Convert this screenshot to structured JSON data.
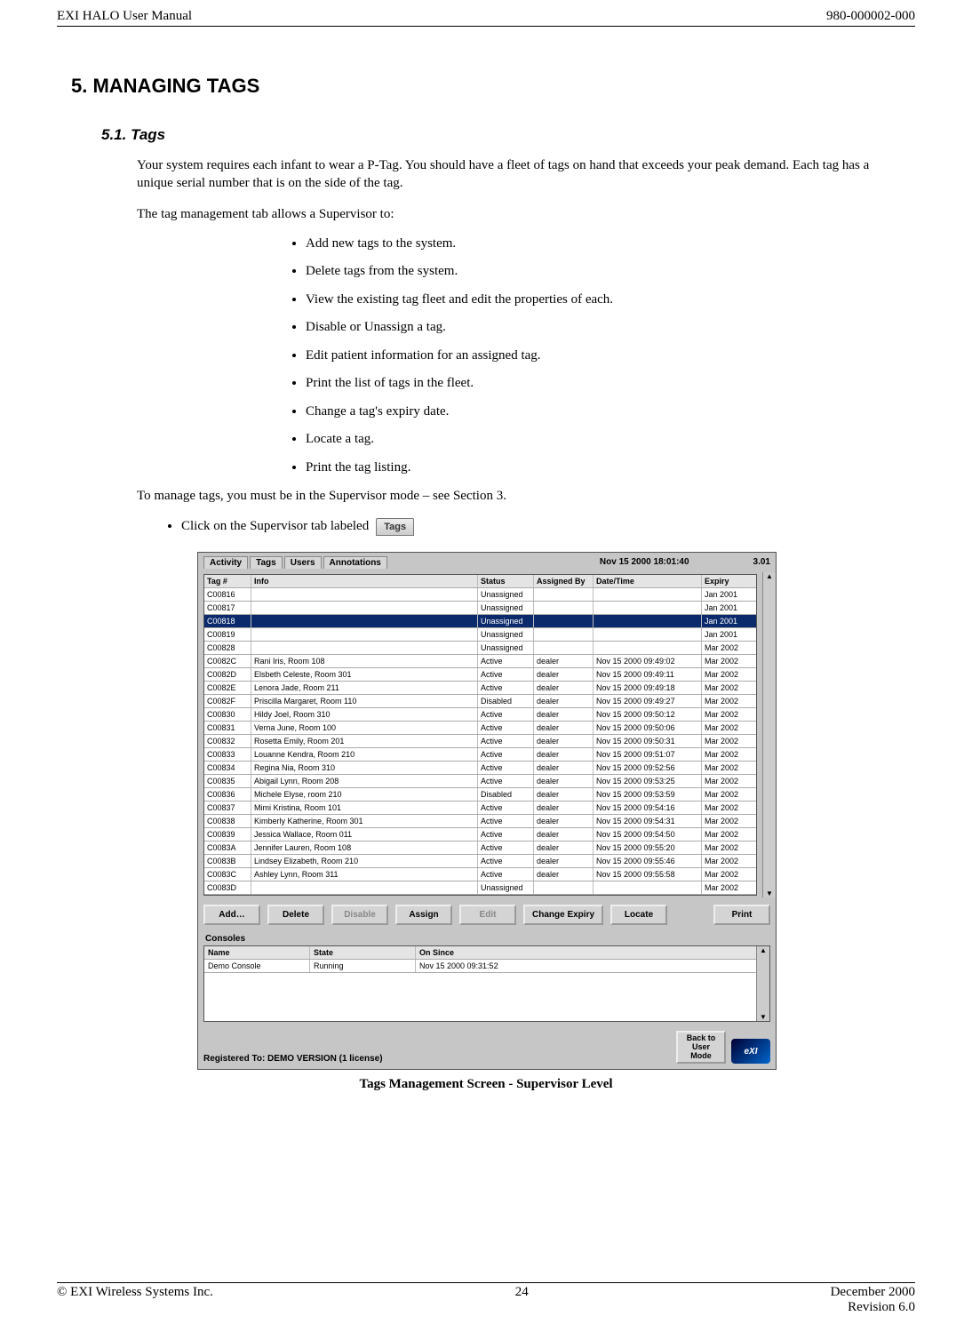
{
  "header": {
    "left": "EXI HALO User Manual",
    "right": "980-000002-000"
  },
  "section": {
    "h1": "5.  MANAGING TAGS",
    "h2": "5.1.  Tags"
  },
  "para1": "Your system requires each infant to wear a P-Tag.  You should have a fleet of tags on hand that exceeds your peak demand.  Each tag has a unique serial number that is on the side of the tag.",
  "para2": "The tag management tab allows a Supervisor to:",
  "bullets": [
    "Add new tags to the system.",
    "Delete tags from the system.",
    "View the existing tag fleet and edit the properties of each.",
    "Disable or Unassign a tag.",
    "Edit patient information for an assigned tag.",
    "Print the list of tags in the fleet.",
    "Change a tag's expiry date.",
    "Locate a tag.",
    "Print the tag listing."
  ],
  "para3": "To manage tags, you must be in the Supervisor mode – see Section 3.",
  "click_line_prefix": "Click on the Supervisor tab labeled",
  "tab_icon_label": "Tags",
  "screenshot": {
    "tabs": [
      "Activity",
      "Tags",
      "Users",
      "Annotations"
    ],
    "clock": "Nov 15 2000  18:01:40",
    "volume": "3.01",
    "columns": {
      "tag": "Tag #",
      "info": "Info",
      "status": "Status",
      "assigned": "Assigned By",
      "date": "Date/Time",
      "expiry": "Expiry"
    },
    "rows": [
      {
        "tag": "C00816",
        "info": "",
        "status": "Unassigned",
        "assigned": "",
        "date": "",
        "expiry": "Jan 2001"
      },
      {
        "tag": "C00817",
        "info": "",
        "status": "Unassigned",
        "assigned": "",
        "date": "",
        "expiry": "Jan 2001"
      },
      {
        "tag": "C00818",
        "info": "",
        "status": "Unassigned",
        "assigned": "",
        "date": "",
        "expiry": "Jan 2001",
        "selected": true
      },
      {
        "tag": "C00819",
        "info": "",
        "status": "Unassigned",
        "assigned": "",
        "date": "",
        "expiry": "Jan 2001"
      },
      {
        "tag": "C00828",
        "info": "",
        "status": "Unassigned",
        "assigned": "",
        "date": "",
        "expiry": "Mar 2002"
      },
      {
        "tag": "C0082C",
        "info": "Rani Iris, Room 108",
        "status": "Active",
        "assigned": "dealer",
        "date": "Nov 15 2000  09:49:02",
        "expiry": "Mar 2002"
      },
      {
        "tag": "C0082D",
        "info": "Elsbeth Celeste, Room 301",
        "status": "Active",
        "assigned": "dealer",
        "date": "Nov 15 2000  09:49:11",
        "expiry": "Mar 2002"
      },
      {
        "tag": "C0082E",
        "info": "Lenora Jade, Room 211",
        "status": "Active",
        "assigned": "dealer",
        "date": "Nov 15 2000  09:49:18",
        "expiry": "Mar 2002"
      },
      {
        "tag": "C0082F",
        "info": "Priscilla Margaret, Room 110",
        "status": "Disabled",
        "assigned": "dealer",
        "date": "Nov 15 2000  09:49:27",
        "expiry": "Mar 2002"
      },
      {
        "tag": "C00830",
        "info": "Hildy Joel, Room 310",
        "status": "Active",
        "assigned": "dealer",
        "date": "Nov 15 2000  09:50:12",
        "expiry": "Mar 2002"
      },
      {
        "tag": "C00831",
        "info": "Verna June, Room 100",
        "status": "Active",
        "assigned": "dealer",
        "date": "Nov 15 2000  09:50:06",
        "expiry": "Mar 2002"
      },
      {
        "tag": "C00832",
        "info": "Rosetta Emily, Room 201",
        "status": "Active",
        "assigned": "dealer",
        "date": "Nov 15 2000  09:50:31",
        "expiry": "Mar 2002"
      },
      {
        "tag": "C00833",
        "info": "Louanne Kendra, Room 210",
        "status": "Active",
        "assigned": "dealer",
        "date": "Nov 15 2000  09:51:07",
        "expiry": "Mar 2002"
      },
      {
        "tag": "C00834",
        "info": "Regina Nia, Room 310",
        "status": "Active",
        "assigned": "dealer",
        "date": "Nov 15 2000  09:52:56",
        "expiry": "Mar 2002"
      },
      {
        "tag": "C00835",
        "info": "Abigail Lynn, Room 208",
        "status": "Active",
        "assigned": "dealer",
        "date": "Nov 15 2000  09:53:25",
        "expiry": "Mar 2002"
      },
      {
        "tag": "C00836",
        "info": "Michele Elyse, room 210",
        "status": "Disabled",
        "assigned": "dealer",
        "date": "Nov 15 2000  09:53:59",
        "expiry": "Mar 2002"
      },
      {
        "tag": "C00837",
        "info": "Mimi Kristina, Room 101",
        "status": "Active",
        "assigned": "dealer",
        "date": "Nov 15 2000  09:54:16",
        "expiry": "Mar 2002"
      },
      {
        "tag": "C00838",
        "info": "Kimberly Katherine, Room 301",
        "status": "Active",
        "assigned": "dealer",
        "date": "Nov 15 2000  09:54:31",
        "expiry": "Mar 2002"
      },
      {
        "tag": "C00839",
        "info": "Jessica Wallace, Room 011",
        "status": "Active",
        "assigned": "dealer",
        "date": "Nov 15 2000  09:54:50",
        "expiry": "Mar 2002"
      },
      {
        "tag": "C0083A",
        "info": "Jennifer Lauren, Room 108",
        "status": "Active",
        "assigned": "dealer",
        "date": "Nov 15 2000  09:55:20",
        "expiry": "Mar 2002"
      },
      {
        "tag": "C0083B",
        "info": "Lindsey Elizabeth, Room 210",
        "status": "Active",
        "assigned": "dealer",
        "date": "Nov 15 2000  09:55:46",
        "expiry": "Mar 2002"
      },
      {
        "tag": "C0083C",
        "info": "Ashley Lynn, Room 311",
        "status": "Active",
        "assigned": "dealer",
        "date": "Nov 15 2000  09:55:58",
        "expiry": "Mar 2002"
      },
      {
        "tag": "C0083D",
        "info": "",
        "status": "Unassigned",
        "assigned": "",
        "date": "",
        "expiry": "Mar 2002"
      }
    ],
    "buttons": {
      "add": "Add…",
      "delete": "Delete",
      "disable": "Disable",
      "assign": "Assign",
      "edit": "Edit",
      "change_expiry": "Change Expiry",
      "locate": "Locate",
      "print": "Print",
      "back": "Back to User Mode"
    },
    "consoles_label": "Consoles",
    "console_columns": {
      "name": "Name",
      "state": "State",
      "since": "On Since"
    },
    "console_rows": [
      {
        "name": "Demo Console",
        "state": "Running",
        "since": "Nov 15 2000  09:31:52"
      }
    ],
    "registered": "Registered To:  DEMO VERSION (1 license)",
    "logo_text": "eXI"
  },
  "caption": "Tags Management Screen - Supervisor Level",
  "footer": {
    "left": "© EXI Wireless Systems Inc.",
    "center": "24",
    "right": "December 2000",
    "rev": "Revision 6.0"
  }
}
